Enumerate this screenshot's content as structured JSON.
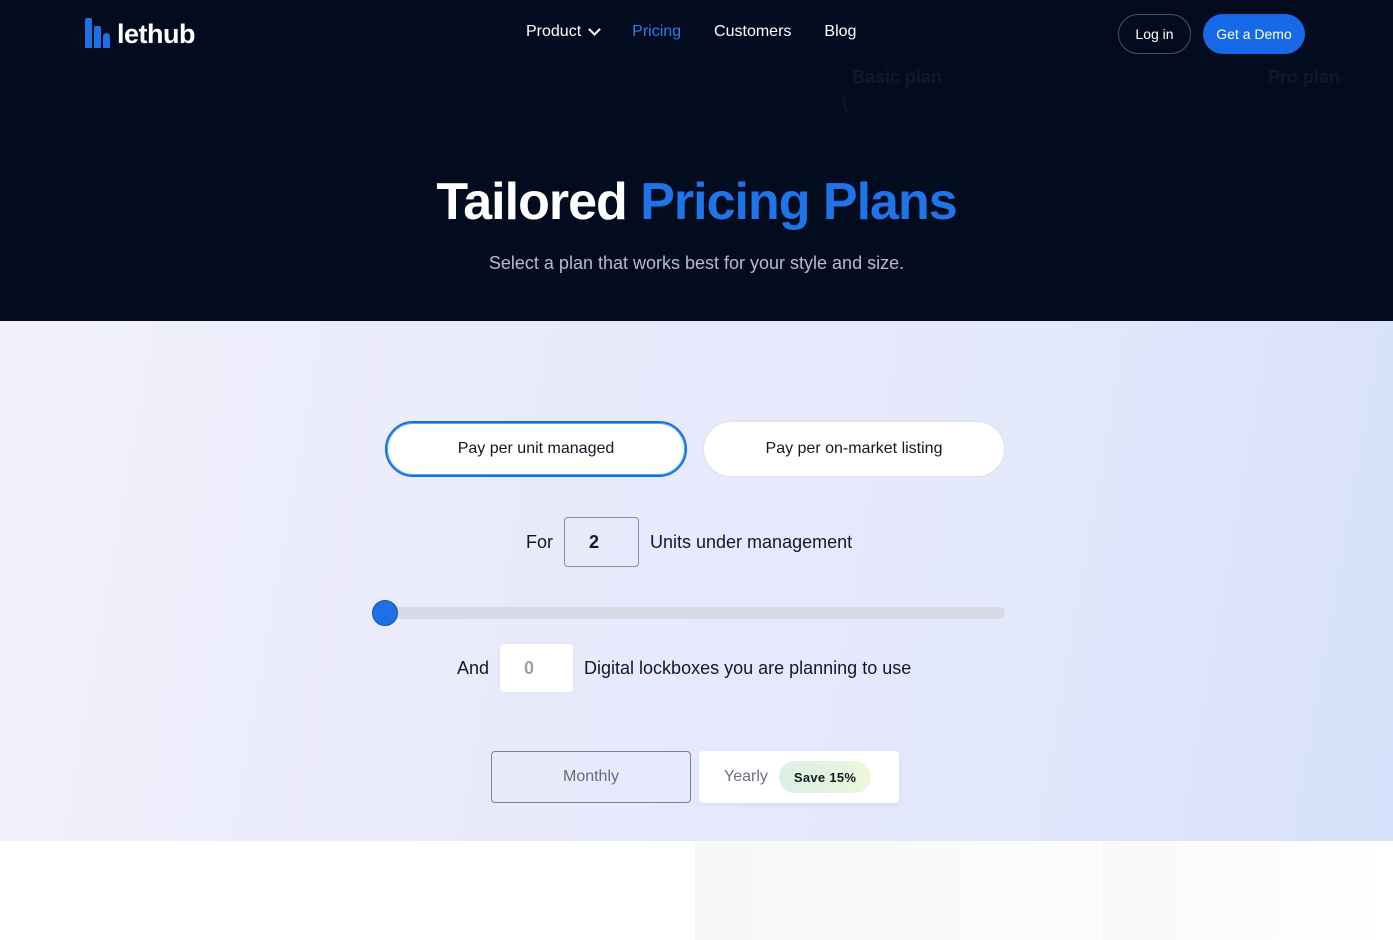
{
  "brand": {
    "name": "lethub"
  },
  "nav": {
    "items": [
      {
        "label": "Product",
        "has_dropdown": true
      },
      {
        "label": "Pricing",
        "active": true
      },
      {
        "label": "Customers"
      },
      {
        "label": "Blog"
      }
    ],
    "login_label": "Log in",
    "demo_label": "Get a Demo"
  },
  "hero": {
    "title_plain": "Tailored",
    "title_accent": "Pricing Plans",
    "subtitle": "Select a plan that works best for your style and size."
  },
  "pricing_mode": {
    "options": [
      {
        "label": "Pay per unit managed",
        "selected": true
      },
      {
        "label": "Pay per on-market listing",
        "selected": false
      }
    ]
  },
  "units": {
    "prefix": "For",
    "value": "2",
    "suffix": "Units under management",
    "slider_level": 0
  },
  "lockboxes": {
    "prefix": "And",
    "value": "0",
    "suffix": "Digital lockboxes you are planning to use"
  },
  "billing": {
    "monthly_label": "Monthly",
    "yearly_label": "Yearly",
    "save_badge": "Save 15%",
    "selected": "yearly"
  },
  "plans": {
    "basic_title": "Basic plan",
    "basic_sub": "(",
    "pro_title": "Pro plan"
  },
  "colors": {
    "hero_bg": "#030c1e",
    "accent": "#1f74e8",
    "button_primary": "#1769e8"
  }
}
